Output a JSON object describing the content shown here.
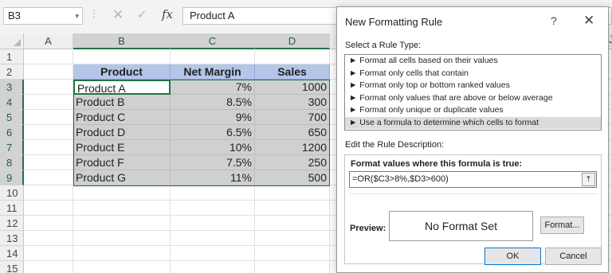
{
  "formula_bar": {
    "name_box": "B3",
    "cancel_glyph": "✕",
    "enter_glyph": "✓",
    "fx_label": "fx",
    "formula_value": "Product A"
  },
  "sheet": {
    "column_headers": [
      "A",
      "B",
      "C",
      "D"
    ],
    "row_headers": [
      "1",
      "2",
      "3",
      "4",
      "5",
      "6",
      "7",
      "8",
      "9",
      "10",
      "11",
      "12",
      "13",
      "14",
      "15"
    ],
    "table_header": [
      "Product",
      "Net Margin",
      "Sales"
    ],
    "rows": [
      [
        "Product A",
        "7%",
        "1000"
      ],
      [
        "Product B",
        "8.5%",
        "300"
      ],
      [
        "Product C",
        "9%",
        "700"
      ],
      [
        "Product D",
        "6.5%",
        "650"
      ],
      [
        "Product E",
        "10%",
        "1200"
      ],
      [
        "Product F",
        "7.5%",
        "250"
      ],
      [
        "Product G",
        "11%",
        "500"
      ]
    ],
    "partial_column_label": "J"
  },
  "dialog": {
    "title": "New Formatting Rule",
    "help_glyph": "?",
    "close_glyph": "✕",
    "select_rule_label": "Select a Rule Type:",
    "rule_types": [
      "► Format all cells based on their values",
      "► Format only cells that contain",
      "► Format only top or bottom ranked values",
      "► Format only values that are above or below average",
      "► Format only unique or duplicate values",
      "► Use a formula to determine which cells to format"
    ],
    "selected_rule_index": 5,
    "edit_desc_label": "Edit the Rule Description:",
    "formula_label": "Format values where this formula is true:",
    "formula": "=OR($C3>8%,$D3>600)",
    "collapse_glyph": "⤒",
    "preview_label": "Preview:",
    "preview_text": "No Format Set",
    "format_button": "Format...",
    "ok_button": "OK",
    "cancel_button": "Cancel"
  },
  "colors": {
    "header_fill": "#b4c6e7",
    "data_fill": "#d0d0d0",
    "selection_border": "#217346"
  }
}
